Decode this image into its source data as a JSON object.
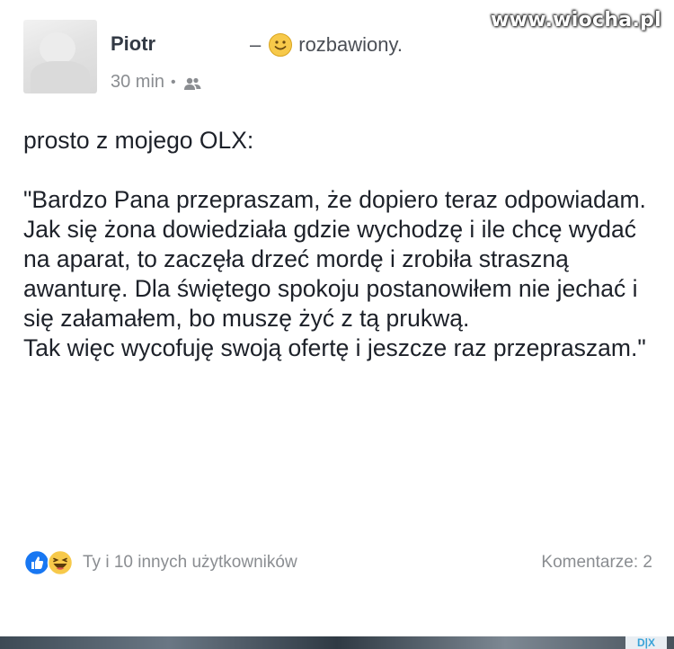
{
  "watermark": "www.wiocha.pl",
  "post": {
    "author": "Piotr",
    "feeling_dash": "–",
    "feeling": "rozbawiony.",
    "time": "30 min",
    "separator": "•",
    "audience_icon": "friends-icon",
    "feeling_icon": "smile-icon",
    "intro": "prosto z mojego OLX:",
    "paragraph": "\"Bardzo Pana przepraszam, że dopiero teraz odpowiadam. Jak się żona dowiedziała gdzie wychodzę i ile chcę wydać na aparat, to zaczęła drzeć mordę i zrobiła straszną awanturę. Dla świętego spokoju postanowiłem nie jechać i się załamałem, bo muszę żyć z tą prukwą.",
    "closing": "Tak więc wycofuję swoją ofertę i jeszcze raz przepraszam.\"",
    "reactions": {
      "icons": [
        "like-icon",
        "haha-icon"
      ],
      "text": "Ty i 10 innych użytkowników"
    },
    "comments": "Komentarze: 2"
  },
  "ad_badge": "D|X",
  "colors": {
    "text": "#1d2129",
    "meta": "#8a8d91",
    "like_blue": "#1877f2",
    "haha_yellow": "#f7c94a"
  }
}
